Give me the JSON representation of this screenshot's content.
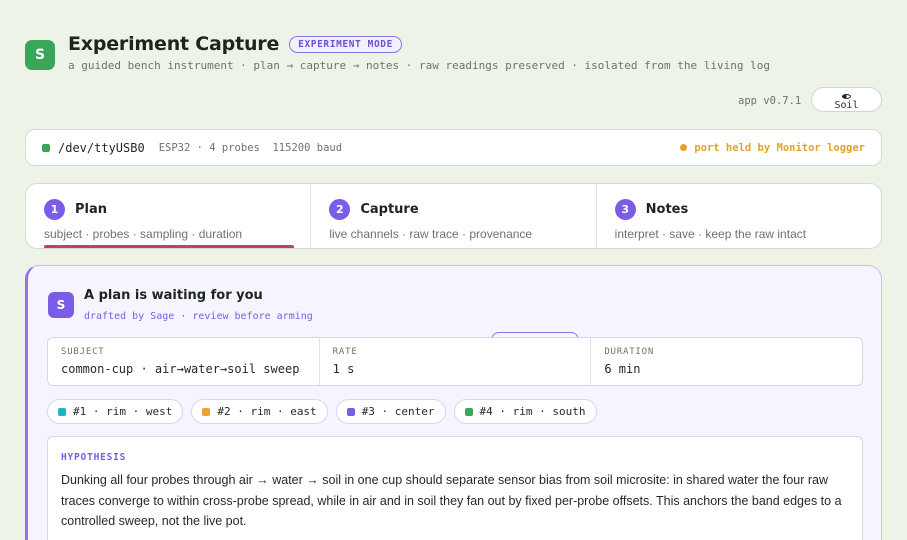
{
  "app": {
    "logo_letter": "S",
    "title": "Experiment Capture",
    "mode_badge": "EXPERIMENT MODE",
    "subtitle": "a guided bench instrument · plan → capture → notes · raw readings preserved · isolated from the living log",
    "version": "app v0.7.1",
    "theme_icon": "half-circle-icon",
    "theme_label": "Soil"
  },
  "port": {
    "name": "/dev/ttyUSB0",
    "meta": "ESP32 · 4 probes  115200 baud",
    "status": "port held by Monitor logger",
    "status_color": "#e0a32a",
    "connected_color": "#3aa65a"
  },
  "steps": [
    {
      "num": "1",
      "title": "Plan",
      "desc": "subject · probes · sampling · duration"
    },
    {
      "num": "2",
      "title": "Capture",
      "desc": "live channels · raw trace · provenance"
    },
    {
      "num": "3",
      "title": "Notes",
      "desc": "interpret · save · keep the raw intact"
    }
  ],
  "plan": {
    "avatar_letter": "S",
    "title": "A plan is waiting for you",
    "subtitle": "drafted by Sage · review before arming",
    "fields": [
      {
        "label": "SUBJECT",
        "value": "common-cup · air→water→soil sweep"
      },
      {
        "label": "RATE",
        "value": "1 s"
      },
      {
        "label": "DURATION",
        "value": "6 min"
      }
    ],
    "probes": [
      {
        "label": "#1 · rim · west",
        "color": "#22b3c4"
      },
      {
        "label": "#2 · rim · east",
        "color": "#f0a030"
      },
      {
        "label": "#3 · center",
        "color": "#7b5ce6"
      },
      {
        "label": "#4 · rim · south",
        "color": "#3aa65a"
      }
    ],
    "hypothesis_label": "HYPOTHESIS",
    "hypothesis": "Dunking all four probes through air → water → soil in one cup should separate sensor bias from soil microsite: in shared water the four raw traces converge to within cross-probe spread, while in air and in soil they fan out by fixed per-probe offsets. This anchors the band edges to a controlled sweep, not the live pot."
  },
  "colors": {
    "accent": "#7b5ce6",
    "brand": "#3aa65a",
    "background": "#eef3e8"
  }
}
